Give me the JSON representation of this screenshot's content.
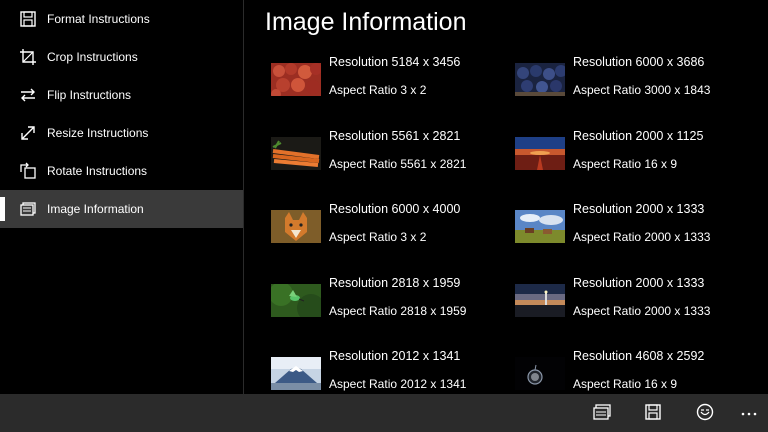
{
  "sidebar": {
    "items": [
      {
        "label": "Format Instructions",
        "icon": "floppy-disk-icon"
      },
      {
        "label": "Crop Instructions",
        "icon": "crop-icon"
      },
      {
        "label": "Flip Instructions",
        "icon": "flip-arrows-icon"
      },
      {
        "label": "Resize Instructions",
        "icon": "resize-arrows-icon"
      },
      {
        "label": "Rotate Instructions",
        "icon": "rotate-icon"
      },
      {
        "label": "Image Information",
        "icon": "image-info-icon",
        "selected": true
      }
    ]
  },
  "main": {
    "title": "Image Information",
    "images": [
      {
        "resolution": "Resolution 5184 x 3456",
        "aspect": "Aspect Ratio 3 x 2",
        "subject": "red berries"
      },
      {
        "resolution": "Resolution 6000 x 3686",
        "aspect": "Aspect Ratio 3000 x 1843",
        "subject": "blueberries"
      },
      {
        "resolution": "Resolution 5561 x 2821",
        "aspect": "Aspect Ratio 5561 x 2821",
        "subject": "carrots"
      },
      {
        "resolution": "Resolution 2000 x 1125",
        "aspect": "Aspect Ratio 16 x 9",
        "subject": "red road at sunset"
      },
      {
        "resolution": "Resolution 6000 x 4000",
        "aspect": "Aspect Ratio 3 x 2",
        "subject": "fox"
      },
      {
        "resolution": "Resolution 2000 x 1333",
        "aspect": "Aspect Ratio 2000 x 1333",
        "subject": "horses in field"
      },
      {
        "resolution": "Resolution 2818 x 1959",
        "aspect": "Aspect Ratio 2818 x 1959",
        "subject": "hummingbird"
      },
      {
        "resolution": "Resolution 2000 x 1333",
        "aspect": "Aspect Ratio 2000 x 1333",
        "subject": "lighthouse dusk"
      },
      {
        "resolution": "Resolution 2012 x 1341",
        "aspect": "Aspect Ratio 2012 x 1341",
        "subject": "mountain fuji"
      },
      {
        "resolution": "Resolution 4608 x 2592",
        "aspect": "Aspect Ratio 16 x 9",
        "subject": "pocket watch"
      }
    ]
  },
  "appbar": {
    "buttons": [
      "image-info-icon",
      "save-icon",
      "emoji-icon",
      "more-icon"
    ]
  },
  "colors": {
    "background": "#000000",
    "sidebar_selected": "#3a3a3a",
    "appbar": "#2b2b2b",
    "text": "#ffffff"
  }
}
